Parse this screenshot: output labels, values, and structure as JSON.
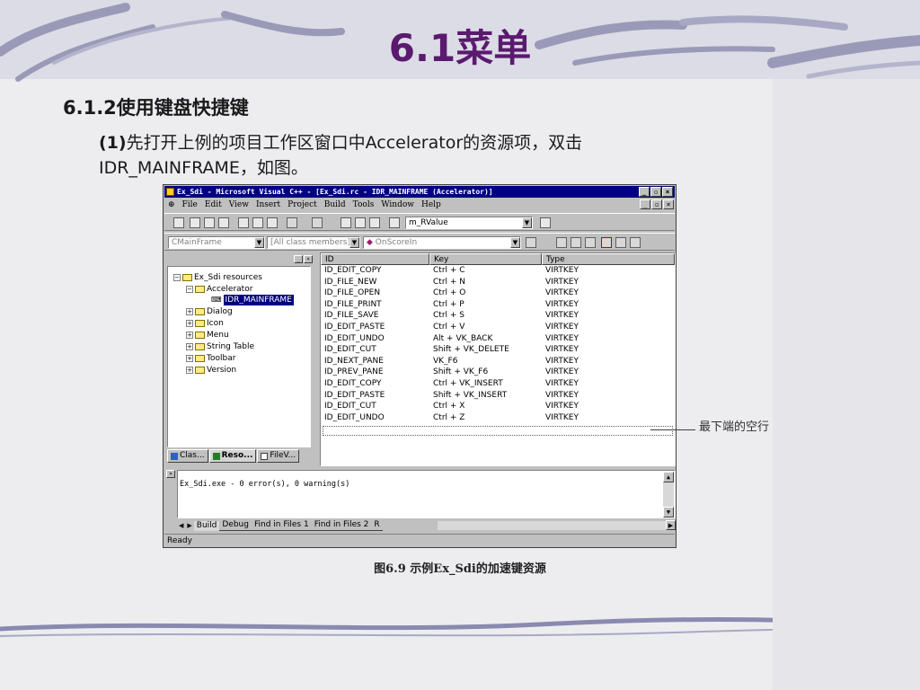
{
  "slide": {
    "title": "6.1菜单",
    "heading": "6.1.2使用键盘快捷键",
    "para_prefix": "(1)",
    "para_line1": "先打开上例的项目工作区窗口中Accelerator的资源项，双击",
    "para_line2": "IDR_MAINFRAME，如图。",
    "annotation": "最下端的空行",
    "caption": "图6.9  示例Ex_Sdi的加速键资源"
  },
  "colors": {
    "title": "#5a1a6e",
    "titlebar": "#000080",
    "selection": "#000080"
  },
  "ide": {
    "title": "Ex_Sdi - Microsoft Visual C++ - [Ex_Sdi.rc - IDR_MAINFRAME (Accelerator)]",
    "menu": [
      "File",
      "Edit",
      "View",
      "Insert",
      "Project",
      "Build",
      "Tools",
      "Window",
      "Help"
    ],
    "toolbar": {
      "find_combo": "m_RValue",
      "class_combo": "CMainFrame",
      "members_combo": "[All class members]",
      "function_combo": "OnScoreIn"
    },
    "tree": {
      "root": "Ex_Sdi resources",
      "items": [
        {
          "label": "Accelerator",
          "expanded": true
        },
        {
          "label": "IDR_MAINFRAME",
          "selected": true
        },
        {
          "label": "Dialog"
        },
        {
          "label": "Icon"
        },
        {
          "label": "Menu"
        },
        {
          "label": "String Table"
        },
        {
          "label": "Toolbar"
        },
        {
          "label": "Version"
        }
      ]
    },
    "workspace_tabs": [
      "Clas...",
      "Reso...",
      "FileV..."
    ],
    "table": {
      "headers": [
        "ID",
        "Key",
        "Type"
      ],
      "rows": [
        [
          "ID_EDIT_COPY",
          "Ctrl + C",
          "VIRTKEY"
        ],
        [
          "ID_FILE_NEW",
          "Ctrl + N",
          "VIRTKEY"
        ],
        [
          "ID_FILE_OPEN",
          "Ctrl + O",
          "VIRTKEY"
        ],
        [
          "ID_FILE_PRINT",
          "Ctrl + P",
          "VIRTKEY"
        ],
        [
          "ID_FILE_SAVE",
          "Ctrl + S",
          "VIRTKEY"
        ],
        [
          "ID_EDIT_PASTE",
          "Ctrl + V",
          "VIRTKEY"
        ],
        [
          "ID_EDIT_UNDO",
          "Alt + VK_BACK",
          "VIRTKEY"
        ],
        [
          "ID_EDIT_CUT",
          "Shift + VK_DELETE",
          "VIRTKEY"
        ],
        [
          "ID_NEXT_PANE",
          "VK_F6",
          "VIRTKEY"
        ],
        [
          "ID_PREV_PANE",
          "Shift + VK_F6",
          "VIRTKEY"
        ],
        [
          "ID_EDIT_COPY",
          "Ctrl + VK_INSERT",
          "VIRTKEY"
        ],
        [
          "ID_EDIT_PASTE",
          "Shift + VK_INSERT",
          "VIRTKEY"
        ],
        [
          "ID_EDIT_CUT",
          "Ctrl + X",
          "VIRTKEY"
        ],
        [
          "ID_EDIT_UNDO",
          "Ctrl + Z",
          "VIRTKEY"
        ]
      ]
    },
    "output_text": "Ex_Sdi.exe - 0 error(s), 0 warning(s)",
    "output_tabs": [
      "Build",
      "Debug",
      "Find in Files 1",
      "Find in Files 2",
      "R"
    ],
    "status": "Ready"
  }
}
